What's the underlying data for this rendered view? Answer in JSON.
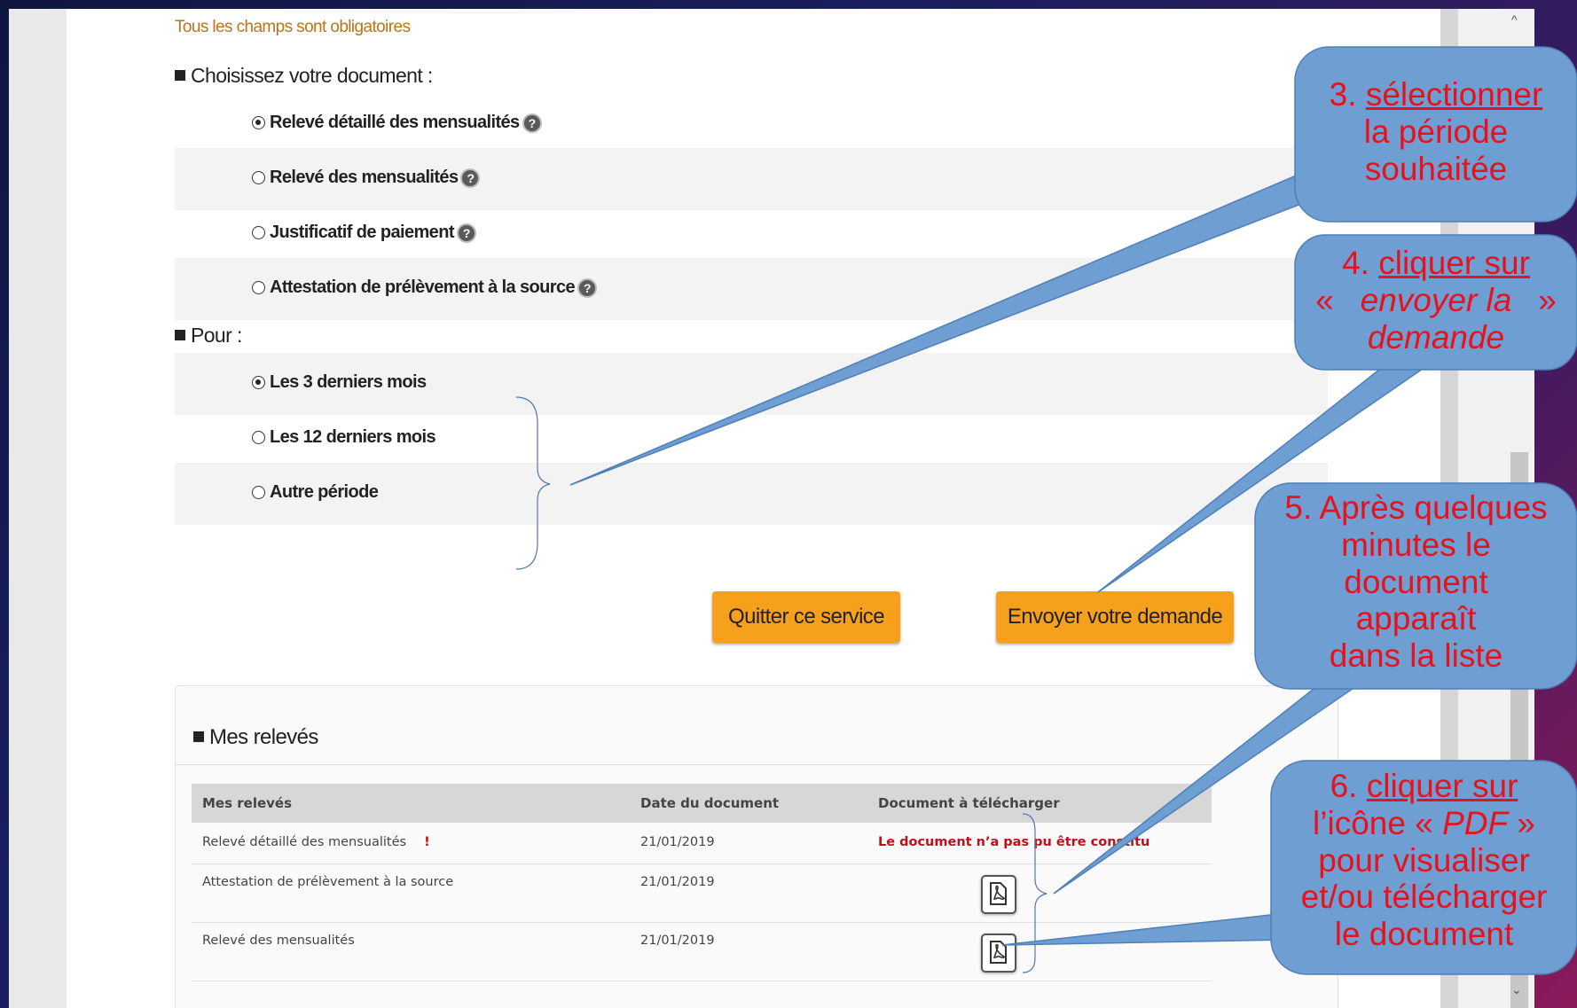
{
  "form": {
    "notice": "Tous les champs sont obligatoires",
    "doc_heading": "Choisissez votre document :",
    "documents": [
      {
        "label": "Relevé détaillé des mensualités",
        "selected": true
      },
      {
        "label": "Relevé des mensualités",
        "selected": false
      },
      {
        "label": "Justificatif de paiement",
        "selected": false
      },
      {
        "label": "Attestation de prélèvement à la source",
        "selected": false
      }
    ],
    "period_heading": "Pour :",
    "periods": [
      {
        "label": "Les 3 derniers mois",
        "selected": true
      },
      {
        "label": "Les 12 derniers mois",
        "selected": false
      },
      {
        "label": "Autre période",
        "selected": false
      }
    ],
    "help_glyph": "?"
  },
  "buttons": {
    "quit": "Quitter ce service",
    "send": "Envoyer votre demande"
  },
  "releves": {
    "title": "Mes relevés",
    "columns": [
      "Mes relevés",
      "Date du document",
      "Document à télécharger"
    ],
    "rows": [
      {
        "name": "Relevé détaillé des mensualités",
        "flag": "!",
        "date": "21/01/2019",
        "download": "Le document n’a pas pu être constitu",
        "has_pdf": false
      },
      {
        "name": "Attestation de prélèvement à la source",
        "flag": "",
        "date": "21/01/2019",
        "download": "",
        "has_pdf": true
      },
      {
        "name": "Relevé des mensualités",
        "flag": "",
        "date": "21/01/2019",
        "download": "",
        "has_pdf": true
      }
    ]
  },
  "scrollbar": {
    "up": "^",
    "down": "⌄"
  },
  "callouts": {
    "c3": {
      "num": "3.",
      "u": "sélectionner",
      "rest": "la période souhaitée"
    },
    "c4": {
      "num": "4.",
      "u": "cliquer sur",
      "q_open": "«",
      "i": "envoyer la demande",
      "q_close": "»"
    },
    "c5": {
      "line1": "5. Après quelques",
      "line2": "minutes le",
      "line3": "document",
      "line4": "apparaît",
      "line5": "dans la liste"
    },
    "c6": {
      "num": "6.",
      "u": "cliquer sur",
      "pre": "l’icône «",
      "i": "PDF",
      "post": "»",
      "line3": "pour visualiser",
      "line4": "et/ou télécharger",
      "line5": "le document"
    }
  },
  "colors": {
    "accent_button": "#f7a01b",
    "callout_fill": "#6e9ed2",
    "callout_text": "#e8121c",
    "error_text": "#c0101b"
  }
}
